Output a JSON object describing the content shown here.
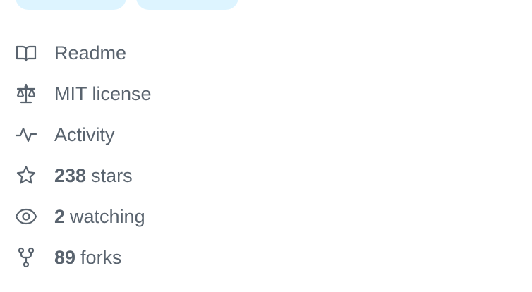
{
  "about": {
    "links": [
      {
        "icon": "book-icon",
        "label": "Readme"
      },
      {
        "icon": "law-icon",
        "label": "MIT license"
      },
      {
        "icon": "pulse-icon",
        "label": "Activity"
      }
    ],
    "stats": {
      "stars": {
        "icon": "star-icon",
        "count": "238",
        "label": "stars"
      },
      "watching": {
        "icon": "eye-icon",
        "count": "2",
        "label": "watching"
      },
      "forks": {
        "icon": "repo-forked-icon",
        "count": "89",
        "label": "forks"
      }
    }
  },
  "colors": {
    "text_muted": "#59636e",
    "topic_tag_bg": "#ddf4ff"
  }
}
